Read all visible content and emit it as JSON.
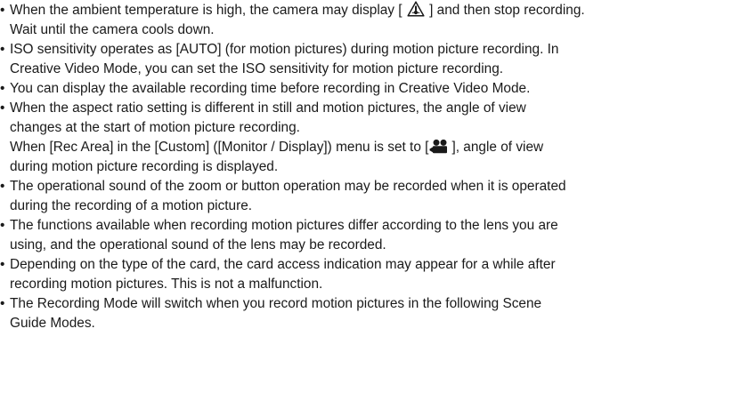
{
  "notes": [
    {
      "lines": [
        [
          "When the ambient temperature is high, the camera may display [ ",
          {
            "icon": "temperature-warning-icon"
          },
          " ] and then stop recording."
        ],
        [
          "Wait until the camera cools down."
        ]
      ]
    },
    {
      "lines": [
        [
          "ISO sensitivity operates as [AUTO] (for motion pictures) during motion picture recording. In"
        ],
        [
          "Creative Video Mode, you can set the ISO sensitivity for motion picture recording."
        ]
      ]
    },
    {
      "lines": [
        [
          "You can display the available recording time before recording in Creative Video Mode."
        ]
      ]
    },
    {
      "lines": [
        [
          "When the aspect ratio setting is different in still and motion pictures, the angle of view"
        ],
        [
          "changes at the start of motion picture recording."
        ],
        [
          "When [Rec Area] in the [Custom] ([Monitor / Display]) menu is set to [",
          {
            "icon": "motion-picture-icon"
          },
          "], angle of view"
        ],
        [
          "during motion picture recording is displayed."
        ]
      ]
    },
    {
      "lines": [
        [
          "The operational sound of the zoom or button operation may be recorded when it is operated"
        ],
        [
          "during the recording of a motion picture."
        ]
      ]
    },
    {
      "lines": [
        [
          "The functions available when recording motion pictures differ according to the lens you are"
        ],
        [
          "using, and the operational sound of the lens may be recorded."
        ]
      ]
    },
    {
      "lines": [
        [
          "Depending on the type of the card, the card access indication may appear for a while after"
        ],
        [
          "recording motion pictures. This is not a malfunction."
        ]
      ]
    },
    {
      "lines": [
        [
          "The Recording Mode will switch when you record motion pictures in the following Scene"
        ],
        [
          "Guide Modes."
        ]
      ]
    }
  ],
  "bullet_char": "•",
  "colors": {
    "text": "#1a1a1a",
    "icon_fill": "#1a1a1a"
  }
}
